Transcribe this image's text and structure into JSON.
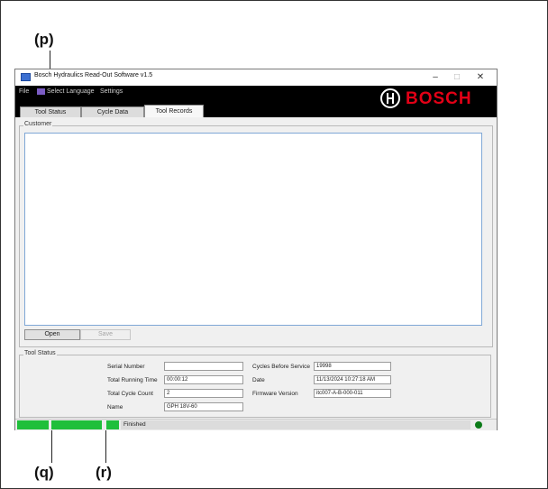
{
  "callouts": {
    "p": "(p)",
    "q": "(q)",
    "r": "(r)"
  },
  "window": {
    "title": "Bosch Hydraulics Read-Out Software v1.5",
    "controls": {
      "minimize": "–",
      "maximize": "□",
      "close": "✕"
    }
  },
  "menu": {
    "file": "File",
    "language": "Select Language",
    "settings": "Settings"
  },
  "brand": {
    "wordmark": "BOSCH",
    "color": "#e30016"
  },
  "tabs": [
    {
      "label": "Tool Status",
      "active": false
    },
    {
      "label": "Cycle Data",
      "active": false
    },
    {
      "label": "Tool Records",
      "active": true
    }
  ],
  "customer": {
    "group_label": "Customer",
    "open_label": "Open",
    "save_label": "Save"
  },
  "tool_status": {
    "group_label": "Tool Status",
    "serial_number": {
      "label": "Serial Number",
      "value": ""
    },
    "total_running_time": {
      "label": "Total Running Time",
      "value": "00:00:12"
    },
    "total_cycle_count": {
      "label": "Total Cycle Count",
      "value": "2"
    },
    "name": {
      "label": "Name",
      "value": "GPH 18V-60"
    },
    "cycles_before_service": {
      "label": "Cycles Before Service",
      "value": "19998"
    },
    "date": {
      "label": "Date",
      "value": "11/13/2024 10:27:18 AM"
    },
    "firmware_version": {
      "label": "Firmware Version",
      "value": "itc007-A-B-000-011"
    }
  },
  "statusbar": {
    "status": "Finished",
    "accent": "#1fbf3b",
    "indicator": "#0b7a18"
  }
}
